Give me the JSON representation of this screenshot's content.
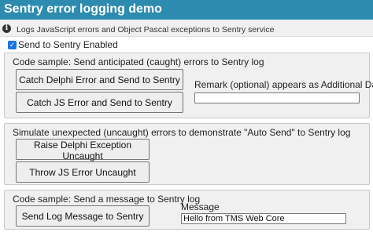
{
  "header": {
    "title": "Sentry error logging demo",
    "subtitle": "Logs JavaScript errors and Object Pascal exceptions to Sentry service",
    "info_icon": "info-icon"
  },
  "send_toggle": {
    "label": "Send to Sentry Enabled",
    "checked": true
  },
  "caught_panel": {
    "label": "Code sample: Send anticipated (caught) errors to Sentry log",
    "catch_delphi_button": "Catch Delphi Error and Send to Sentry",
    "catch_js_button": "Catch JS Error and Send to Sentry",
    "remark_label": "Remark (optional) appears as Additional Data",
    "remark_value": ""
  },
  "uncaught_panel": {
    "label": "Simulate unexpected (uncaught) errors to demonstrate \"Auto Send\" to Sentry log",
    "raise_delphi_button": "Raise Delphi Exception Uncaught",
    "throw_js_button": "Throw JS Error Uncaught"
  },
  "message_panel": {
    "label": "Code sample: Send a message to Sentry log",
    "send_button": "Send Log Message to Sentry",
    "message_label": "Message",
    "message_value": "Hello from TMS Web Core"
  }
}
